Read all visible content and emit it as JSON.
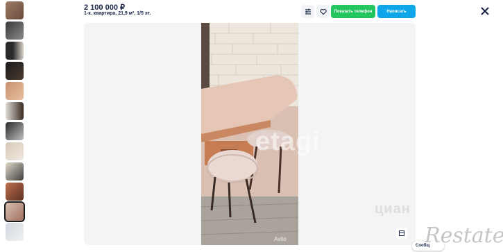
{
  "listing": {
    "price": "2 100 000 ₽",
    "subtitle": "1-к. квартира, 21,9 м², 1/5 эт."
  },
  "actions": {
    "show_phone": "Показать телефон",
    "write": "Написать",
    "compare_icon": "compare-icon",
    "favorite_icon": "heart-icon",
    "close_icon": "close-icon"
  },
  "thumbnails": [
    {
      "icon": "photo-thumbnail"
    },
    {
      "icon": "photo-thumbnail"
    },
    {
      "icon": "photo-thumbnail"
    },
    {
      "icon": "photo-thumbnail"
    },
    {
      "icon": "photo-thumbnail"
    },
    {
      "icon": "photo-thumbnail"
    },
    {
      "icon": "photo-thumbnail"
    },
    {
      "icon": "photo-thumbnail"
    },
    {
      "icon": "photo-thumbnail"
    },
    {
      "icon": "photo-thumbnail"
    },
    {
      "icon": "photo-thumbnail",
      "active": true
    },
    {
      "icon": "photo-thumbnail"
    }
  ],
  "viewer": {
    "watermark": "etagi",
    "avito": "Avito",
    "cian": "циан"
  },
  "chat": {
    "label": "Сообщ"
  },
  "overlay": {
    "restate": "Restate"
  },
  "colors": {
    "brand_text": "#152242",
    "phone_button": "#22c55e",
    "write_button": "#0ea5e9"
  }
}
